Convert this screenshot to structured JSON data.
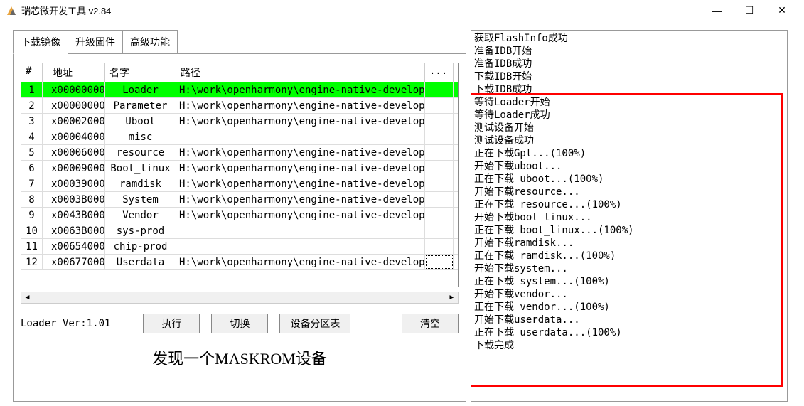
{
  "window": {
    "title": "瑞芯微开发工具 v2.84"
  },
  "tabs": [
    {
      "label": "下载镜像",
      "active": true
    },
    {
      "label": "升级固件",
      "active": false
    },
    {
      "label": "高级功能",
      "active": false
    }
  ],
  "table": {
    "headers": {
      "idx": "#",
      "addr": "地址",
      "name": "名字",
      "path": "路径",
      "dots": "..."
    },
    "rows": [
      {
        "idx": "1",
        "addr": "x00000000",
        "name": "Loader",
        "path": "H:\\work\\openharmony\\engine-native-develop...",
        "selected": true
      },
      {
        "idx": "2",
        "addr": "x00000000",
        "name": "Parameter",
        "path": "H:\\work\\openharmony\\engine-native-develop..."
      },
      {
        "idx": "3",
        "addr": "x00002000",
        "name": "Uboot",
        "path": "H:\\work\\openharmony\\engine-native-develop..."
      },
      {
        "idx": "4",
        "addr": "x00004000",
        "name": "misc",
        "path": ""
      },
      {
        "idx": "5",
        "addr": "x00006000",
        "name": "resource",
        "path": "H:\\work\\openharmony\\engine-native-develop..."
      },
      {
        "idx": "6",
        "addr": "x00009000",
        "name": "Boot_linux",
        "path": "H:\\work\\openharmony\\engine-native-develop..."
      },
      {
        "idx": "7",
        "addr": "x00039000",
        "name": "ramdisk",
        "path": "H:\\work\\openharmony\\engine-native-develop..."
      },
      {
        "idx": "8",
        "addr": "x0003B000",
        "name": "System",
        "path": "H:\\work\\openharmony\\engine-native-develop..."
      },
      {
        "idx": "9",
        "addr": "x0043B000",
        "name": "Vendor",
        "path": "H:\\work\\openharmony\\engine-native-develop..."
      },
      {
        "idx": "10",
        "addr": "x0063B000",
        "name": "sys-prod",
        "path": ""
      },
      {
        "idx": "11",
        "addr": "x00654000",
        "name": "chip-prod",
        "path": ""
      },
      {
        "idx": "12",
        "addr": "x00677000",
        "name": "Userdata",
        "path": "H:\\work\\openharmony\\engine-native-develop...",
        "focus": true
      }
    ]
  },
  "loader_ver": "Loader Ver:1.01",
  "buttons": {
    "exec": "执行",
    "switch": "切换",
    "partition": "设备分区表",
    "clear": "清空"
  },
  "status": "发现一个MASKROM设备",
  "log": [
    "获取FlashInfo成功",
    "准备IDB开始",
    "准备IDB成功",
    "下载IDB开始",
    "下载IDB成功",
    "等待Loader开始",
    "等待Loader成功",
    "测试设备开始",
    "测试设备成功",
    "正在下载Gpt...(100%)",
    "开始下载uboot...",
    "正在下载 uboot...(100%)",
    "开始下载resource...",
    "正在下载 resource...(100%)",
    "开始下载boot_linux...",
    "正在下载 boot_linux...(100%)",
    "开始下载ramdisk...",
    "正在下载 ramdisk...(100%)",
    "开始下载system...",
    "正在下载 system...(100%)",
    "开始下载vendor...",
    "正在下载 vendor...(100%)",
    "开始下载userdata...",
    "正在下载 userdata...(100%)",
    "下载完成"
  ]
}
